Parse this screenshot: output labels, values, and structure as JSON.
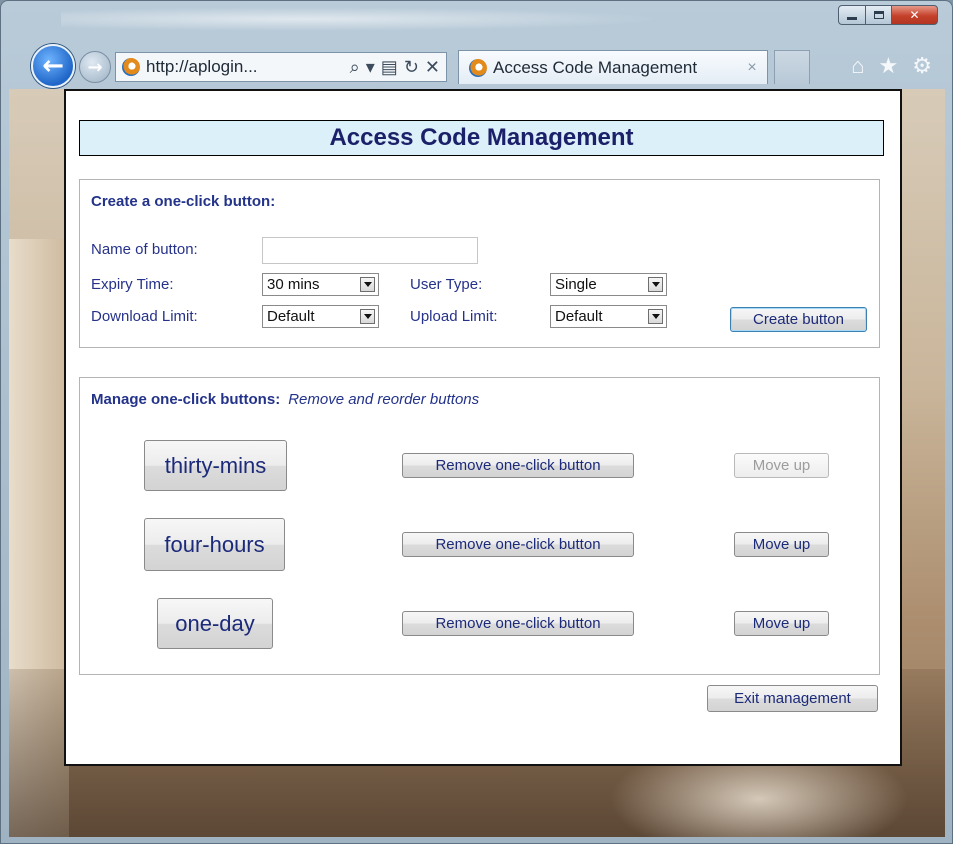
{
  "browser": {
    "address_url": "http://aplogin...",
    "address_icons": [
      "search-icon",
      "dropdown-icon",
      "compat-view-icon",
      "refresh-icon",
      "stop-icon"
    ],
    "tab_title": "Access Code Management",
    "tab_close": "×",
    "toolbar_icons": [
      "home-icon",
      "favorites-icon",
      "tools-gear-icon"
    ]
  },
  "page": {
    "title": "Access Code Management",
    "create": {
      "heading": "Create a one-click button:",
      "name_label": "Name of button:",
      "name_value": "",
      "expiry_label": "Expiry Time:",
      "expiry_value": "30 mins",
      "user_type_label": "User Type:",
      "user_type_value": "Single",
      "download_label": "Download Limit:",
      "download_value": "Default",
      "upload_label": "Upload Limit:",
      "upload_value": "Default",
      "create_button": "Create button"
    },
    "manage": {
      "heading": "Manage one-click buttons:",
      "subheading": "Remove and reorder buttons",
      "rows": [
        {
          "name": "thirty-mins",
          "remove": "Remove one-click button",
          "move_up": "Move up",
          "move_up_enabled": false
        },
        {
          "name": "four-hours",
          "remove": "Remove one-click button",
          "move_up": "Move up",
          "move_up_enabled": true
        },
        {
          "name": "one-day",
          "remove": "Remove one-click button",
          "move_up": "Move up",
          "move_up_enabled": true
        }
      ]
    },
    "exit_button": "Exit management"
  },
  "colors": {
    "text_accent": "#23338a",
    "title_bg": "#dcf0f9",
    "close_button": "#c4412a"
  }
}
